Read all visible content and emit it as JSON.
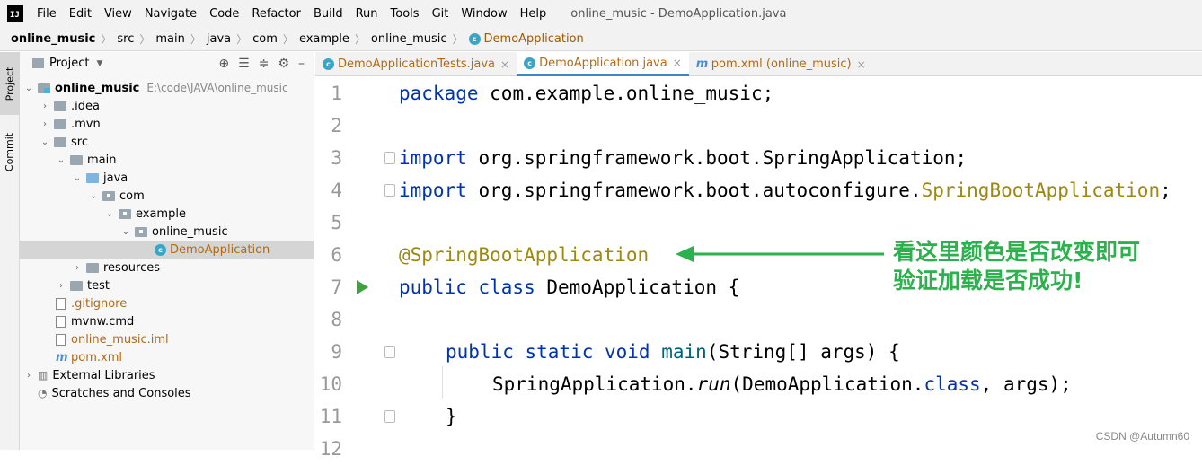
{
  "app": {
    "logo_text": "IJ",
    "window_title": "online_music - DemoApplication.java"
  },
  "menu": [
    "File",
    "Edit",
    "View",
    "Navigate",
    "Code",
    "Refactor",
    "Build",
    "Run",
    "Tools",
    "Git",
    "Window",
    "Help"
  ],
  "breadcrumb": [
    "online_music",
    "src",
    "main",
    "java",
    "com",
    "example",
    "online_music",
    "DemoApplication"
  ],
  "tool_strip": {
    "project": "Project",
    "commit": "Commit"
  },
  "project_panel": {
    "title": "Project",
    "tree": [
      {
        "label": "online_music",
        "path": "E:\\code\\JAVA\\online_music"
      },
      {
        "label": ".idea"
      },
      {
        "label": ".mvn"
      },
      {
        "label": "src"
      },
      {
        "label": "main"
      },
      {
        "label": "java"
      },
      {
        "label": "com"
      },
      {
        "label": "example"
      },
      {
        "label": "online_music"
      },
      {
        "label": "DemoApplication"
      },
      {
        "label": "resources"
      },
      {
        "label": "test"
      },
      {
        "label": ".gitignore"
      },
      {
        "label": "mvnw.cmd"
      },
      {
        "label": "online_music.iml"
      },
      {
        "label": "pom.xml"
      },
      {
        "label": "External Libraries"
      },
      {
        "label": "Scratches and Consoles"
      }
    ]
  },
  "editor_tabs": [
    {
      "label": "DemoApplicationTests.java"
    },
    {
      "label": "DemoApplication.java"
    },
    {
      "label": "pom.xml (online_music)"
    }
  ],
  "code": {
    "line_numbers": [
      "1",
      "2",
      "3",
      "4",
      "5",
      "6",
      "7",
      "8",
      "9",
      "10",
      "11",
      "12"
    ],
    "l1_kw": "package",
    "l1_rest": " com.example.online_music;",
    "l3_kw": "import",
    "l3_rest": " org.springframework.boot.SpringApplication;",
    "l4_kw": "import",
    "l4_rest": " org.springframework.boot.autoconfigure.",
    "l4_ann": "SpringBootApplication",
    "l4_end": ";",
    "l6_ann": "@SpringBootApplication",
    "l7_kw": "public class",
    "l7_rest": " DemoApplication {",
    "l9_kw": "public static void",
    "l9_fn": " main",
    "l9_rest": "(String[] args) {",
    "l10_a": "SpringApplication.",
    "l10_run": "run",
    "l10_b": "(DemoApplication.",
    "l10_kw": "class",
    "l10_c": ", args);",
    "l11": "}"
  },
  "annotation": {
    "line1": "看这里颜色是否改变即可",
    "line2": "验证加载是否成功!",
    "color": "#2bb24c"
  },
  "watermark": "CSDN @Autumn60"
}
